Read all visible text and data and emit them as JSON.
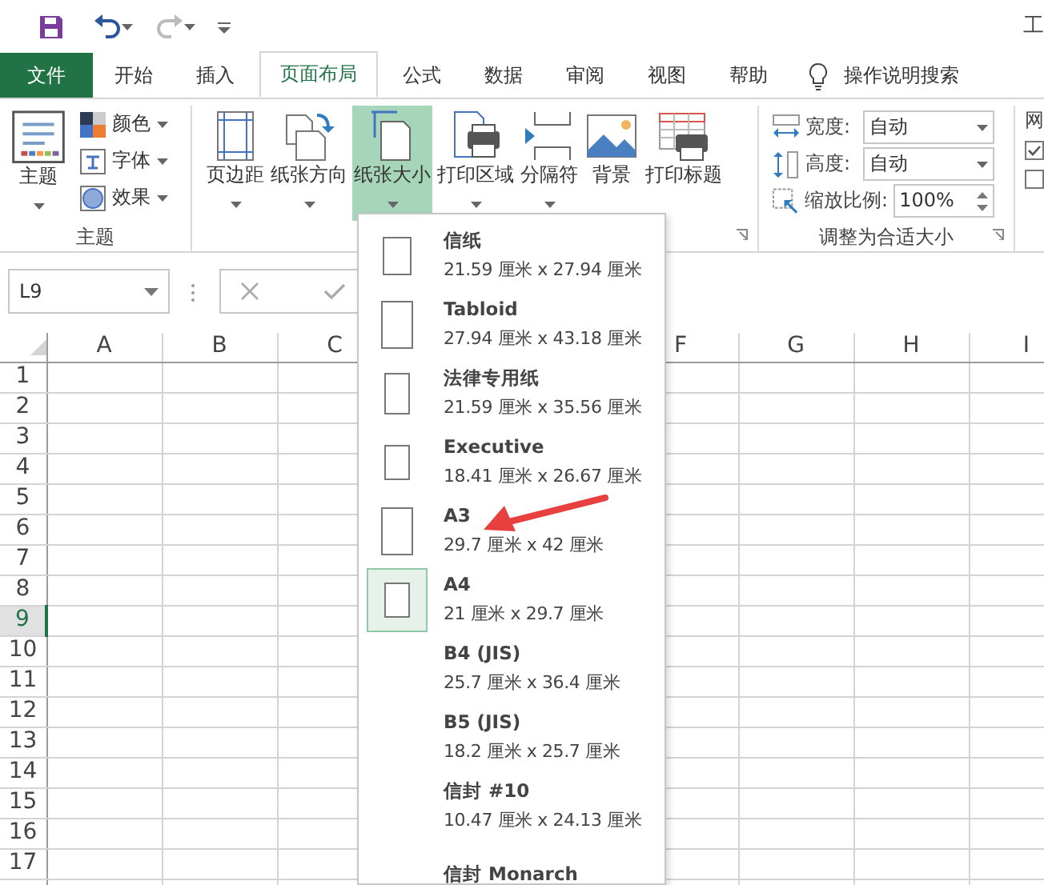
{
  "window_title": "工",
  "tabs": [
    {
      "label": "文件",
      "kind": "file",
      "selected": false
    },
    {
      "label": "开始",
      "kind": "tab",
      "selected": false
    },
    {
      "label": "插入",
      "kind": "tab",
      "selected": false
    },
    {
      "label": "页面布局",
      "kind": "tab",
      "selected": true
    },
    {
      "label": "公式",
      "kind": "tab",
      "selected": false
    },
    {
      "label": "数据",
      "kind": "tab",
      "selected": false
    },
    {
      "label": "审阅",
      "kind": "tab",
      "selected": false
    },
    {
      "label": "视图",
      "kind": "tab",
      "selected": false
    },
    {
      "label": "帮助",
      "kind": "tab",
      "selected": false
    }
  ],
  "tell_me": "操作说明搜索",
  "ribbon": {
    "themes": {
      "button": "主题",
      "options": [
        "颜色",
        "字体",
        "效果"
      ],
      "label": "主题"
    },
    "page_setup": {
      "buttons": [
        {
          "label": "页边距",
          "dropdown": true,
          "selected": false
        },
        {
          "label": "纸张方向",
          "dropdown": true,
          "selected": false
        },
        {
          "label": "纸张大小",
          "dropdown": true,
          "selected": true
        },
        {
          "label": "打印区域",
          "dropdown": true,
          "selected": false
        },
        {
          "label": "分隔符",
          "dropdown": true,
          "selected": false
        },
        {
          "label": "背景",
          "dropdown": false,
          "selected": false
        },
        {
          "label": "打印标题",
          "dropdown": false,
          "selected": false
        }
      ]
    },
    "scale": {
      "rows": [
        {
          "label": "宽度:",
          "value": "自动",
          "kind": "select"
        },
        {
          "label": "高度:",
          "value": "自动",
          "kind": "select"
        },
        {
          "label": "缩放比例:",
          "value": "100%",
          "kind": "spin"
        }
      ],
      "label": "调整为合适大小"
    },
    "sheet_options": {
      "label": "网",
      "checkboxes": [
        {
          "checked": true
        },
        {
          "checked": false
        }
      ]
    }
  },
  "name_box": "L9",
  "columns_left": [
    "A",
    "B",
    "C"
  ],
  "columns_right": [
    "F",
    "G",
    "H",
    "I"
  ],
  "rows": [
    {
      "label": "1",
      "selected": false
    },
    {
      "label": "2",
      "selected": false
    },
    {
      "label": "3",
      "selected": false
    },
    {
      "label": "4",
      "selected": false
    },
    {
      "label": "5",
      "selected": false
    },
    {
      "label": "6",
      "selected": false
    },
    {
      "label": "7",
      "selected": false
    },
    {
      "label": "8",
      "selected": false
    },
    {
      "label": "9",
      "selected": true
    },
    {
      "label": "10",
      "selected": false
    },
    {
      "label": "11",
      "selected": false
    },
    {
      "label": "12",
      "selected": false
    },
    {
      "label": "13",
      "selected": false
    },
    {
      "label": "14",
      "selected": false
    },
    {
      "label": "15",
      "selected": false
    },
    {
      "label": "16",
      "selected": false
    },
    {
      "label": "17",
      "selected": false
    }
  ],
  "paper_menu": [
    {
      "name": "信纸",
      "size": "21.59 厘米 x 27.94 厘米",
      "kind": "medium",
      "selected": false
    },
    {
      "name": "Tabloid",
      "size": "27.94 厘米 x 43.18 厘米",
      "kind": "large",
      "selected": false
    },
    {
      "name": "法律专用纸",
      "size": "21.59 厘米 x 35.56 厘米",
      "kind": "narrow",
      "selected": false
    },
    {
      "name": "Executive",
      "size": "18.41 厘米 x 26.67 厘米",
      "kind": "small",
      "selected": false
    },
    {
      "name": "A3",
      "size": "29.7 厘米 x 42 厘米",
      "kind": "large",
      "selected": false
    },
    {
      "name": "A4",
      "size": "21 厘米 x 29.7 厘米",
      "kind": "small",
      "selected": true
    },
    {
      "name": "B4 (JIS)",
      "size": "25.7 厘米 x 36.4 厘米",
      "kind": "none",
      "selected": false
    },
    {
      "name": "B5 (JIS)",
      "size": "18.2 厘米 x 25.7 厘米",
      "kind": "none",
      "selected": false
    },
    {
      "name": "信封 #10",
      "size": "10.47 厘米 x 24.13 厘米",
      "kind": "none",
      "selected": false
    },
    {
      "name": "信封 Monarch",
      "kind": "none",
      "selected": false
    }
  ]
}
